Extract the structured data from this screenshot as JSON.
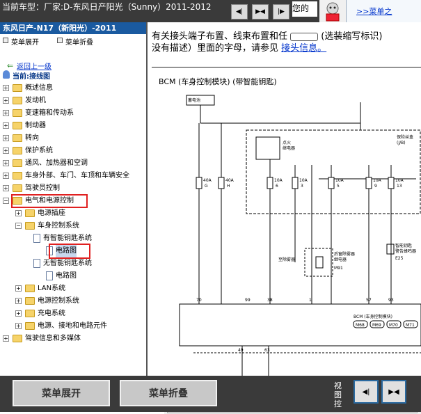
{
  "topbar": {
    "vehicle": "当前车型：厂家:D-东风日产阳光（Sunny）2011-2012",
    "nav_buttons": [
      "prev-arrow-icon",
      "split-icon",
      "next-arrow-icon"
    ],
    "hello": "您的",
    "promo_link": ">>菜单之"
  },
  "sidebar": {
    "model": "东风日产-N17（新阳光）-2011",
    "expand_label": "菜单展开",
    "collapse_label": "菜单折叠",
    "back_link": "返回上一级",
    "current_label": "当前:接线图",
    "tree": [
      {
        "label": "概述信息",
        "level": 0,
        "expanded": false
      },
      {
        "label": "发动机",
        "level": 0,
        "expanded": false
      },
      {
        "label": "变速箱和传动系",
        "level": 0,
        "expanded": false
      },
      {
        "label": "制动器",
        "level": 0,
        "expanded": false
      },
      {
        "label": "转向",
        "level": 0,
        "expanded": false
      },
      {
        "label": "保护系统",
        "level": 0,
        "expanded": false
      },
      {
        "label": "通风、加热器和空调",
        "level": 0,
        "expanded": false
      },
      {
        "label": "车身外部、车门、车顶和车辆安全",
        "level": 0,
        "expanded": false
      },
      {
        "label": "驾驶员控制",
        "level": 0,
        "expanded": false
      },
      {
        "label": "电气和电源控制",
        "level": 0,
        "expanded": true,
        "highlight": true
      },
      {
        "label": "电源插座",
        "level": 1,
        "expanded": false
      },
      {
        "label": "车身控制系统",
        "level": 1,
        "expanded": true
      },
      {
        "label": "有智能钥匙系统",
        "level": 2,
        "doc": true
      },
      {
        "label": "电路图",
        "level": 3,
        "doc": false,
        "selected": true,
        "highlight": true
      },
      {
        "label": "无智能钥匙系统",
        "level": 2,
        "doc": true
      },
      {
        "label": "电路图",
        "level": 3,
        "doc": false
      },
      {
        "label": "LAN系统",
        "level": 1,
        "expanded": false
      },
      {
        "label": "电源控制系统",
        "level": 1,
        "expanded": false
      },
      {
        "label": "充电系统",
        "level": 1,
        "expanded": false
      },
      {
        "label": "电源、接地和电路元件",
        "level": 1,
        "expanded": false
      },
      {
        "label": "驾驶信息和多媒体",
        "level": 0,
        "expanded": false
      }
    ]
  },
  "content": {
    "info_text_1": "有关接头端子布置、线束布置和任",
    "info_text_2": "(选装缩写标识)",
    "info_text_3": "没有描述）里面的字母，请参见",
    "connector_link": "接头信息。",
    "diagram": {
      "title": "BCM (车身控制模块) (带智能钥匙)",
      "battery": "蓄电池",
      "fuse_box": "保险丝盒",
      "fuse_box_sub": "(J/B)",
      "ignition_relay": "点火",
      "ignition_relay_2": "继电器",
      "fuses": [
        {
          "rating": "40A",
          "id": "G"
        },
        {
          "rating": "40A",
          "id": "H"
        },
        {
          "rating": "10A",
          "id": "6"
        },
        {
          "rating": "10A",
          "id": "3"
        },
        {
          "rating": "10A",
          "id": "5"
        },
        {
          "rating": "10A",
          "id": "9"
        },
        {
          "rating": "10A",
          "id": "13"
        }
      ],
      "relay_label_1": "后窗除雾器",
      "relay_label_2": "继电器",
      "relay_conn": "M91",
      "defogger_label": "至除雾器",
      "smart_key_1": "智能钥匙",
      "smart_key_2": "警告蜂鸣器",
      "smart_key_conn": "E25",
      "pins_top": [
        "70",
        "99",
        "38",
        "1",
        "57",
        "93"
      ],
      "pins_bottom": [
        "49",
        "63"
      ],
      "bcm_label": "BCM (车身控制模块)",
      "bcm_conns": [
        "M68",
        "M69",
        "M70",
        "M71"
      ]
    }
  },
  "bottombar": {
    "expand_btn": "菜单展开",
    "collapse_btn": "菜单折叠",
    "view_label": "视图控"
  },
  "colors": {
    "dark_bar": "#3a3a3a",
    "model_bar": "#1a5aa0",
    "highlight": "#e02020",
    "link": "#0033cc"
  }
}
